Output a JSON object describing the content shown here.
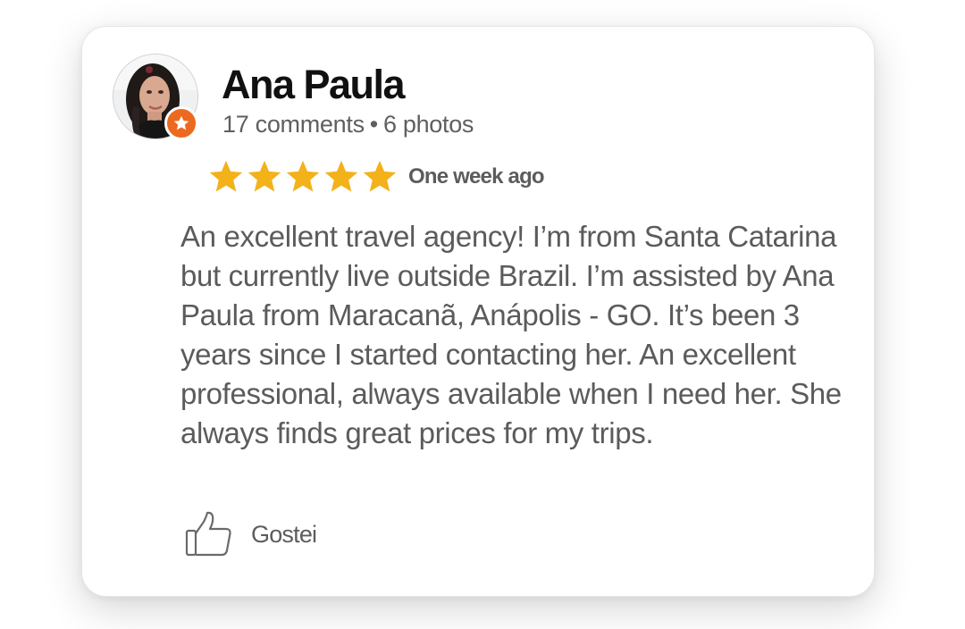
{
  "review": {
    "author": {
      "name": "Ana Paula",
      "comments": "17 comments",
      "separator": "•",
      "photos": "6 photos",
      "avatar_icon": "profile-photo",
      "badge_icon": "star-icon",
      "badge_color": "#ec6a1f"
    },
    "rating": {
      "stars": 5,
      "max": 5,
      "star_color": "#f3b11a"
    },
    "date": "One week ago",
    "text": "An excellent travel agency! I’m from Santa Catarina but currently live outside Brazil. I’m assisted by Ana Paula from Maracanã, Anápolis - GO. It’s been 3 years since I started contacting her. An excellent professional, always available when I need her. She always finds great prices for my trips.",
    "like": {
      "label": "Gostei",
      "icon": "thumbs-up-icon"
    }
  }
}
